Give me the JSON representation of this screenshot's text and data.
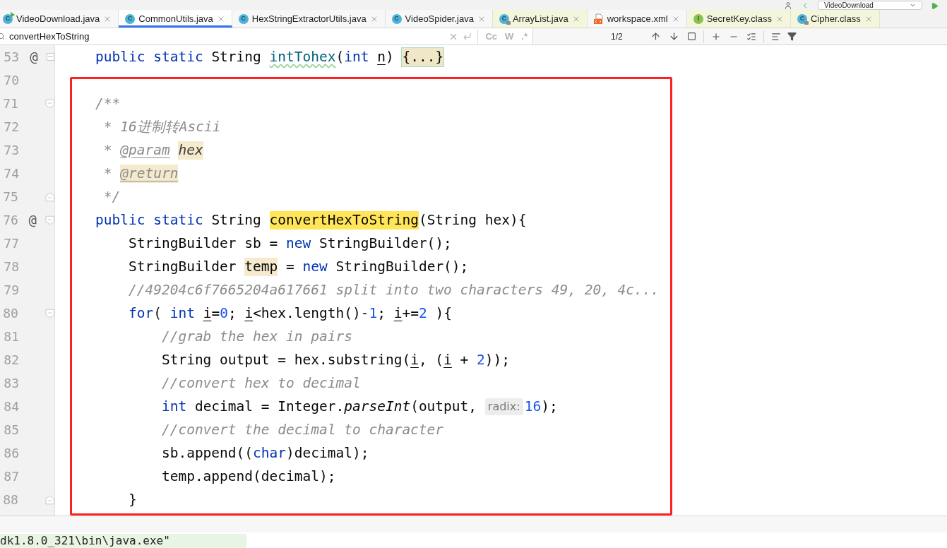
{
  "toolbar": {
    "run_config": "VideoDownload"
  },
  "tabs": [
    {
      "label": "VideoDownload.java",
      "selected": false,
      "library": false,
      "icon": {
        "kind": "runnable",
        "letter": "C"
      }
    },
    {
      "label": "CommonUtils.java",
      "selected": true,
      "library": false,
      "icon": {
        "kind": "class",
        "letter": "C"
      }
    },
    {
      "label": "HexStringExtractorUtils.java",
      "selected": false,
      "library": false,
      "icon": {
        "kind": "class",
        "letter": "C"
      }
    },
    {
      "label": "VideoSpider.java",
      "selected": false,
      "library": false,
      "icon": {
        "kind": "class",
        "letter": "C"
      }
    },
    {
      "label": "ArrayList.java",
      "selected": false,
      "library": true,
      "icon": {
        "kind": "locked_class",
        "letter": "C"
      }
    },
    {
      "label": "workspace.xml",
      "selected": false,
      "library": false,
      "icon": {
        "kind": "xml"
      }
    },
    {
      "label": "SecretKey.class",
      "selected": false,
      "library": true,
      "icon": {
        "kind": "interface",
        "letter": "I"
      }
    },
    {
      "label": "Cipher.class",
      "selected": false,
      "library": true,
      "icon": {
        "kind": "locked_class",
        "letter": "C"
      }
    }
  ],
  "find_bar": {
    "value": "convertHexToString",
    "options": [
      {
        "label": "Cc",
        "on": false
      },
      {
        "label": "W",
        "on": false
      },
      {
        "label": ".*",
        "on": false
      }
    ],
    "match_count": "1/2"
  },
  "lines": [
    {
      "number": "53",
      "marker": "@",
      "gutter_icon": {
        "kind": "fold_expand"
      },
      "tokens": [
        {
          "text": "public static ",
          "kind": "kw"
        },
        {
          "text": "String ",
          "kind": "plain"
        },
        {
          "text": "intTohex",
          "kind": "method"
        },
        {
          "text": "(",
          "kind": "plain"
        },
        {
          "text": "int ",
          "kind": "kw"
        },
        {
          "text": "n",
          "kind": "reassigned"
        },
        {
          "text": ") ",
          "kind": "plain"
        },
        {
          "text": "{...}",
          "kind": "folded"
        }
      ]
    },
    {
      "number": "70"
    },
    {
      "number": "71",
      "gutter_icon": {
        "kind": "fold_start"
      },
      "tokens": [
        {
          "text": "/**",
          "kind": "doc"
        }
      ]
    },
    {
      "number": "72",
      "tokens": [
        {
          "text": " * 16进制转Ascii",
          "kind": "doc"
        }
      ]
    },
    {
      "number": "73",
      "tokens": [
        {
          "text": " * ",
          "kind": "doc"
        },
        {
          "text": "@param",
          "kind": "doctag"
        },
        {
          "text": "hex",
          "kind": "docparam"
        }
      ]
    },
    {
      "number": "74",
      "tokens": [
        {
          "text": " * ",
          "kind": "doc"
        },
        {
          "text": "@return",
          "kind": "doctag_usage"
        }
      ]
    },
    {
      "number": "75",
      "gutter_icon": {
        "kind": "fold_end"
      },
      "tokens": [
        {
          "text": " */",
          "kind": "doc"
        }
      ]
    },
    {
      "number": "76",
      "marker": "@",
      "gutter_icon": {
        "kind": "fold_start"
      },
      "tokens": [
        {
          "text": "public static ",
          "kind": "kw"
        },
        {
          "text": "String ",
          "kind": "plain"
        },
        {
          "text": "convertHexToString",
          "kind": "match"
        },
        {
          "text": "(String hex){",
          "kind": "plain"
        }
      ]
    },
    {
      "number": "77",
      "tokens": [
        {
          "text": "    StringBuilder sb = ",
          "kind": "plain"
        },
        {
          "text": "new ",
          "kind": "kw"
        },
        {
          "text": "StringBuilder();",
          "kind": "plain"
        }
      ]
    },
    {
      "number": "78",
      "tokens": [
        {
          "text": "    StringBuilder ",
          "kind": "plain"
        },
        {
          "text": "temp",
          "kind": "usage"
        },
        {
          "text": " = ",
          "kind": "plain"
        },
        {
          "text": "new ",
          "kind": "kw"
        },
        {
          "text": "StringBuilder();",
          "kind": "plain"
        }
      ]
    },
    {
      "number": "79",
      "tokens": [
        {
          "text": "    //49204c6f7665204a617661 split into two characters 49, 20, 4c...",
          "kind": "comment"
        }
      ]
    },
    {
      "number": "80",
      "gutter_icon": {
        "kind": "fold_start"
      },
      "tokens": [
        {
          "text": "    for",
          "kind": "kw"
        },
        {
          "text": "( ",
          "kind": "plain"
        },
        {
          "text": "int ",
          "kind": "kw"
        },
        {
          "text": "i",
          "kind": "reassigned"
        },
        {
          "text": "=",
          "kind": "plain"
        },
        {
          "text": "0",
          "kind": "num"
        },
        {
          "text": "; ",
          "kind": "plain"
        },
        {
          "text": "i",
          "kind": "reassigned"
        },
        {
          "text": "<hex.length()-",
          "kind": "plain"
        },
        {
          "text": "1",
          "kind": "num"
        },
        {
          "text": "; ",
          "kind": "plain"
        },
        {
          "text": "i",
          "kind": "reassigned"
        },
        {
          "text": "+=",
          "kind": "plain"
        },
        {
          "text": "2",
          "kind": "num"
        },
        {
          "text": " ){",
          "kind": "plain"
        }
      ]
    },
    {
      "number": "81",
      "tokens": [
        {
          "text": "        //grab the hex in pairs",
          "kind": "comment"
        }
      ]
    },
    {
      "number": "82",
      "tokens": [
        {
          "text": "        String output = hex.substring(",
          "kind": "plain"
        },
        {
          "text": "i",
          "kind": "reassigned"
        },
        {
          "text": ", (",
          "kind": "plain"
        },
        {
          "text": "i",
          "kind": "reassigned"
        },
        {
          "text": " + ",
          "kind": "plain"
        },
        {
          "text": "2",
          "kind": "num"
        },
        {
          "text": "));",
          "kind": "plain"
        }
      ]
    },
    {
      "number": "83",
      "tokens": [
        {
          "text": "        //convert hex to decimal",
          "kind": "comment"
        }
      ]
    },
    {
      "number": "84",
      "tokens": [
        {
          "text": "        int ",
          "kind": "kw"
        },
        {
          "text": "decimal = Integer.",
          "kind": "plain"
        },
        {
          "text": "parseInt",
          "kind": "static_call"
        },
        {
          "text": "(output, ",
          "kind": "plain"
        },
        {
          "text": "radix:",
          "kind": "hint"
        },
        {
          "text": "16",
          "kind": "num"
        },
        {
          "text": ");",
          "kind": "plain"
        }
      ]
    },
    {
      "number": "85",
      "tokens": [
        {
          "text": "        //convert the decimal to character",
          "kind": "comment"
        }
      ]
    },
    {
      "number": "86",
      "tokens": [
        {
          "text": "        sb.append((",
          "kind": "plain"
        },
        {
          "text": "char",
          "kind": "kw"
        },
        {
          "text": ")decimal);",
          "kind": "plain"
        }
      ]
    },
    {
      "number": "87",
      "tokens": [
        {
          "text": "        temp.append(decimal);",
          "kind": "plain"
        }
      ]
    },
    {
      "number": "88",
      "gutter_icon": {
        "kind": "fold_end"
      },
      "tokens": [
        {
          "text": "    }",
          "kind": "plain"
        }
      ]
    }
  ],
  "console": {
    "text": "dk1.8.0_321\\bin\\java.exe\""
  }
}
